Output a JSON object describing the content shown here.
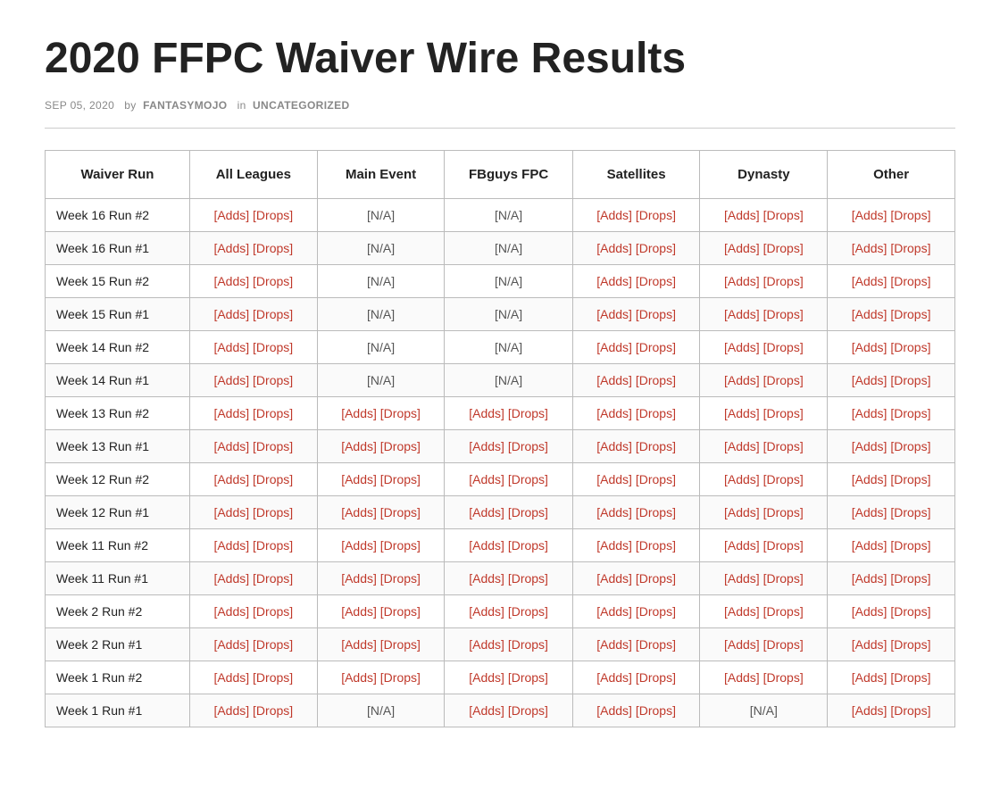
{
  "title": "2020 FFPC Waiver Wire Results",
  "meta": {
    "date": "SEP 05, 2020",
    "by": "by",
    "author": "FANTASYMOJO",
    "in": "in",
    "category": "UNCATEGORIZED"
  },
  "table": {
    "headers": [
      "Waiver Run",
      "All Leagues",
      "Main Event",
      "FBguys FPC",
      "Satellites",
      "Dynasty",
      "Other"
    ],
    "rows": [
      {
        "label": "Week 16 Run #2",
        "allLeagues": {
          "adds": "[Adds]",
          "drops": "[Drops]"
        },
        "mainEvent": "NA",
        "fbguysFpc": "NA",
        "satellites": {
          "adds": "[Adds]",
          "drops": "[Drops]"
        },
        "dynasty": {
          "adds": "[Adds]",
          "drops": "[Drops]"
        },
        "other": {
          "adds": "[Adds]",
          "drops": "[Drops]"
        }
      },
      {
        "label": "Week 16 Run #1",
        "allLeagues": {
          "adds": "[Adds]",
          "drops": "[Drops]"
        },
        "mainEvent": "NA",
        "fbguysFpc": "NA",
        "satellites": {
          "adds": "[Adds]",
          "drops": "[Drops]"
        },
        "dynasty": {
          "adds": "[Adds]",
          "drops": "[Drops]"
        },
        "other": {
          "adds": "[Adds]",
          "drops": "[Drops]"
        }
      },
      {
        "label": "Week 15 Run #2",
        "allLeagues": {
          "adds": "[Adds]",
          "drops": "[Drops]"
        },
        "mainEvent": "NA",
        "fbguysFpc": "NA",
        "satellites": {
          "adds": "[Adds]",
          "drops": "[Drops]"
        },
        "dynasty": {
          "adds": "[Adds]",
          "drops": "[Drops]"
        },
        "other": {
          "adds": "[Adds]",
          "drops": "[Drops]"
        }
      },
      {
        "label": "Week 15 Run #1",
        "allLeagues": {
          "adds": "[Adds]",
          "drops": "[Drops]"
        },
        "mainEvent": "NA",
        "fbguysFpc": "NA",
        "satellites": {
          "adds": "[Adds]",
          "drops": "[Drops]"
        },
        "dynasty": {
          "adds": "[Adds]",
          "drops": "[Drops]"
        },
        "other": {
          "adds": "[Adds]",
          "drops": "[Drops]"
        }
      },
      {
        "label": "Week 14 Run #2",
        "allLeagues": {
          "adds": "[Adds]",
          "drops": "[Drops]"
        },
        "mainEvent": "NA",
        "fbguysFpc": "NA",
        "satellites": {
          "adds": "[Adds]",
          "drops": "[Drops]"
        },
        "dynasty": {
          "adds": "[Adds]",
          "drops": "[Drops]"
        },
        "other": {
          "adds": "[Adds]",
          "drops": "[Drops]"
        }
      },
      {
        "label": "Week 14 Run #1",
        "allLeagues": {
          "adds": "[Adds]",
          "drops": "[Drops]"
        },
        "mainEvent": "NA",
        "fbguysFpc": "NA",
        "satellites": {
          "adds": "[Adds]",
          "drops": "[Drops]"
        },
        "dynasty": {
          "adds": "[Adds]",
          "drops": "[Drops]"
        },
        "other": {
          "adds": "[Adds]",
          "drops": "[Drops]"
        }
      },
      {
        "label": "Week 13 Run #2",
        "allLeagues": {
          "adds": "[Adds]",
          "drops": "[Drops]"
        },
        "mainEvent": {
          "adds": "[Adds]",
          "drops": "[Drops]"
        },
        "fbguysFpc": {
          "adds": "[Adds]",
          "drops": "[Drops]"
        },
        "satellites": {
          "adds": "[Adds]",
          "drops": "[Drops]"
        },
        "dynasty": {
          "adds": "[Adds]",
          "drops": "[Drops]"
        },
        "other": {
          "adds": "[Adds]",
          "drops": "[Drops]"
        }
      },
      {
        "label": "Week 13 Run #1",
        "allLeagues": {
          "adds": "[Adds]",
          "drops": "[Drops]"
        },
        "mainEvent": {
          "adds": "[Adds]",
          "drops": "[Drops]"
        },
        "fbguysFpc": {
          "adds": "[Adds]",
          "drops": "[Drops]"
        },
        "satellites": {
          "adds": "[Adds]",
          "drops": "[Drops]"
        },
        "dynasty": {
          "adds": "[Adds]",
          "drops": "[Drops]"
        },
        "other": {
          "adds": "[Adds]",
          "drops": "[Drops]"
        }
      },
      {
        "label": "Week 12 Run #2",
        "allLeagues": {
          "adds": "[Adds]",
          "drops": "[Drops]"
        },
        "mainEvent": {
          "adds": "[Adds]",
          "drops": "[Drops]"
        },
        "fbguysFpc": {
          "adds": "[Adds]",
          "drops": "[Drops]"
        },
        "satellites": {
          "adds": "[Adds]",
          "drops": "[Drops]"
        },
        "dynasty": {
          "adds": "[Adds]",
          "drops": "[Drops]"
        },
        "other": {
          "adds": "[Adds]",
          "drops": "[Drops]"
        }
      },
      {
        "label": "Week 12 Run #1",
        "allLeagues": {
          "adds": "[Adds]",
          "drops": "[Drops]"
        },
        "mainEvent": {
          "adds": "[Adds]",
          "drops": "[Drops]"
        },
        "fbguysFpc": {
          "adds": "[Adds]",
          "drops": "[Drops]"
        },
        "satellites": {
          "adds": "[Adds]",
          "drops": "[Drops]"
        },
        "dynasty": {
          "adds": "[Adds]",
          "drops": "[Drops]"
        },
        "other": {
          "adds": "[Adds]",
          "drops": "[Drops]"
        }
      },
      {
        "label": "Week 11 Run #2",
        "allLeagues": {
          "adds": "[Adds]",
          "drops": "[Drops]"
        },
        "mainEvent": {
          "adds": "[Adds]",
          "drops": "[Drops]"
        },
        "fbguysFpc": {
          "adds": "[Adds]",
          "drops": "[Drops]"
        },
        "satellites": {
          "adds": "[Adds]",
          "drops": "[Drops]"
        },
        "dynasty": {
          "adds": "[Adds]",
          "drops": "[Drops]"
        },
        "other": {
          "adds": "[Adds]",
          "drops": "[Drops]"
        }
      },
      {
        "label": "Week 11 Run #1",
        "allLeagues": {
          "adds": "[Adds]",
          "drops": "[Drops]"
        },
        "mainEvent": {
          "adds": "[Adds]",
          "drops": "[Drops]"
        },
        "fbguysFpc": {
          "adds": "[Adds]",
          "drops": "[Drops]"
        },
        "satellites": {
          "adds": "[Adds]",
          "drops": "[Drops]"
        },
        "dynasty": {
          "adds": "[Adds]",
          "drops": "[Drops]"
        },
        "other": {
          "adds": "[Adds]",
          "drops": "[Drops]"
        }
      },
      {
        "label": "Week 2 Run #2",
        "allLeagues": {
          "adds": "[Adds]",
          "drops": "[Drops]"
        },
        "mainEvent": {
          "adds": "[Adds]",
          "drops": "[Drops]"
        },
        "fbguysFpc": {
          "adds": "[Adds]",
          "drops": "[Drops]"
        },
        "satellites": {
          "adds": "[Adds]",
          "drops": "[Drops]"
        },
        "dynasty": {
          "adds": "[Adds]",
          "drops": "[Drops]"
        },
        "other": {
          "adds": "[Adds]",
          "drops": "[Drops]"
        }
      },
      {
        "label": "Week 2 Run #1",
        "allLeagues": {
          "adds": "[Adds]",
          "drops": "[Drops]"
        },
        "mainEvent": {
          "adds": "[Adds]",
          "drops": "[Drops]"
        },
        "fbguysFpc": {
          "adds": "[Adds]",
          "drops": "[Drops]"
        },
        "satellites": {
          "adds": "[Adds]",
          "drops": "[Drops]"
        },
        "dynasty": {
          "adds": "[Adds]",
          "drops": "[Drops]"
        },
        "other": {
          "adds": "[Adds]",
          "drops": "[Drops]"
        }
      },
      {
        "label": "Week 1 Run #2",
        "allLeagues": {
          "adds": "[Adds]",
          "drops": "[Drops]"
        },
        "mainEvent": {
          "adds": "[Adds]",
          "drops": "[Drops]"
        },
        "fbguysFpc": {
          "adds": "[Adds]",
          "drops": "[Drops]"
        },
        "satellites": {
          "adds": "[Adds]",
          "drops": "[Drops]"
        },
        "dynasty": {
          "adds": "[Adds]",
          "drops": "[Drops]"
        },
        "other": {
          "adds": "[Adds]",
          "drops": "[Drops]"
        }
      },
      {
        "label": "Week 1 Run #1",
        "allLeagues": {
          "adds": "[Adds]",
          "drops": "[Drops]"
        },
        "mainEvent": "NA",
        "fbguysFpc": {
          "adds": "[Adds]",
          "drops": "[Drops]"
        },
        "satellites": {
          "adds": "[Adds]",
          "drops": "[Drops]"
        },
        "dynasty": "NA",
        "other": {
          "adds": "[Adds]",
          "drops": "[Drops]"
        }
      }
    ]
  }
}
